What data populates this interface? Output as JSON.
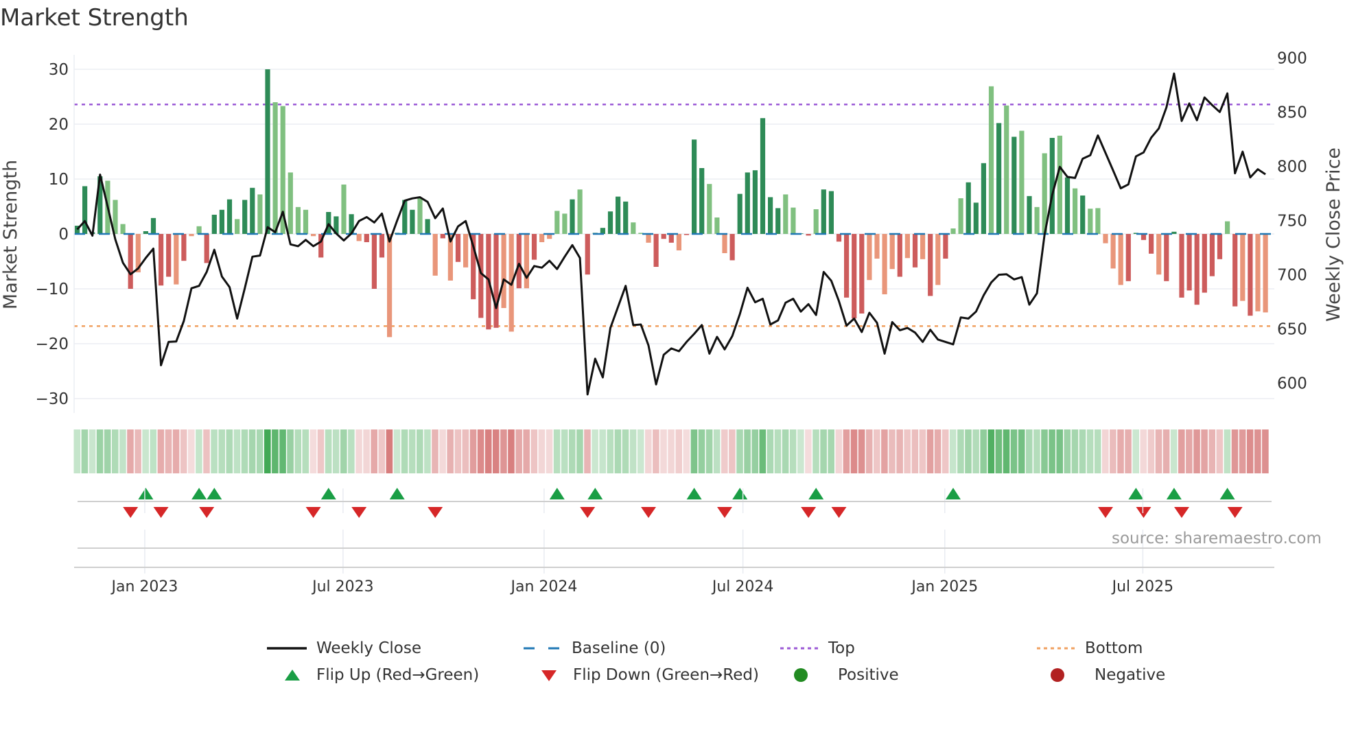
{
  "title": "Market Strength",
  "source": "source: sharemaestro.com",
  "legend": {
    "weekly_close": "Weekly Close",
    "baseline": "Baseline (0)",
    "top": "Top",
    "bottom": "Bottom",
    "flip_up": "Flip Up (Red→Green)",
    "flip_down": "Flip Down (Green→Red)",
    "positive": "Positive",
    "negative": "Negative"
  },
  "colors": {
    "strong_positive": "#2e8b57",
    "weak_positive": "#80c080",
    "strong_negative": "#cd5c5c",
    "weak_negative": "#e9967a",
    "line": "#111111",
    "baseline": "#1f77b4",
    "top": "#9b59d6",
    "bottom": "#f0a060",
    "flip_up": "#1a9e45",
    "flip_down": "#d62728",
    "positive_dot": "#228b22",
    "negative_dot": "#b22222"
  },
  "chart_data": {
    "type": "bar+line",
    "title": "Market Strength",
    "ylabel": "Market Strength",
    "y2label": "Weekly Close Price",
    "ylim": [
      -33,
      33
    ],
    "yticks": [
      30,
      20,
      10,
      0,
      -10,
      -20,
      -30
    ],
    "ytick_labels": [
      "30",
      "20",
      "10",
      "0",
      "−10",
      "−20",
      "−30"
    ],
    "y2ticks": [
      900,
      850,
      800,
      750,
      700,
      650,
      600
    ],
    "y2tick_labels": [
      "900",
      "850",
      "800",
      "750",
      "700",
      "650",
      "600"
    ],
    "x_unit": "week index (weekly, ~Nov 2022 – Oct 2025)",
    "xticks": [
      {
        "week": 8.87,
        "label": "Jan 2023"
      },
      {
        "week": 34.9,
        "label": "Jul 2023"
      },
      {
        "week": 61.3,
        "label": "Jan 2024"
      },
      {
        "week": 87.4,
        "label": "Jul 2024"
      },
      {
        "week": 113.9,
        "label": "Jan 2025"
      },
      {
        "week": 139.9,
        "label": "Jul 2025"
      }
    ],
    "top_level": 23.6,
    "bottom_level": -16.8,
    "baseline": 0,
    "strength": [
      1.5,
      8.7,
      0.3,
      10.5,
      9.7,
      6.2,
      1.8,
      -10,
      -7,
      0.5,
      2.9,
      -9.4,
      -7.8,
      -9.2,
      -4.9,
      -0.4,
      1.4,
      -5.3,
      3.5,
      4.4,
      6.3,
      2.7,
      6.2,
      8.4,
      7.2,
      30,
      24,
      23.3,
      11.2,
      4.9,
      4.4,
      -0.4,
      -4.3,
      4,
      3.2,
      9,
      3.6,
      -1.3,
      -1.5,
      -10,
      -4.3,
      -18.8,
      0.2,
      6.2,
      4.4,
      6.6,
      2.7,
      -7.6,
      -0.8,
      -8.5,
      -5.1,
      -6.1,
      -11.9,
      -15.3,
      -17.4,
      -17.1,
      -13.5,
      -17.8,
      -9.9,
      -9.9,
      -4.7,
      -1.5,
      -0.9,
      4.2,
      3.7,
      6.3,
      8.1,
      -7.4,
      0.2,
      1.1,
      4.1,
      6.8,
      5.9,
      2.1,
      0.2,
      -1.6,
      -6,
      -0.9,
      -1.6,
      -3,
      -0.2,
      17.2,
      12,
      9.1,
      3,
      -3.5,
      -4.8,
      7.3,
      11.2,
      11.6,
      21.1,
      6.7,
      4.7,
      7.2,
      4.8,
      0.1,
      -0.3,
      4.5,
      8.1,
      7.8,
      -1.4,
      -11.6,
      -15.4,
      -14.5,
      -8.4,
      -4.5,
      -11,
      -6.4,
      -7.8,
      -4.4,
      -6.1,
      -4.6,
      -11.3,
      -9.3,
      -4.5,
      1,
      6.5,
      9.4,
      5.7,
      12.9,
      26.9,
      20.2,
      23.4,
      17.7,
      18.8,
      6.9,
      4.9,
      14.7,
      17.5,
      17.9,
      10.3,
      8.3,
      7,
      4.6,
      4.7,
      -1.7,
      -6.3,
      -9.3,
      -8.6,
      0.2,
      -1.1,
      -3.6,
      -7.4,
      -8.6,
      0.4,
      -11.6,
      -10.3,
      -12.9,
      -10.7,
      -7.7,
      -4.6,
      2.3,
      -13.2,
      -12.2,
      -14.9,
      -14.1,
      -14.3
    ],
    "strength_tone": "ddddllldlddddldllddddlddldlllllldddldldddldddldldldlddddlldldlllldlddddddllldddldddllldddddddllddlddddddlllldldldldlldddldldldlldldldlllllddddlddddddddldldlllddldldlld",
    "weekly_close": [
      741.7,
      749.4,
      735.9,
      792.3,
      762.8,
      732.6,
      711,
      700.3,
      705.7,
      715.4,
      724,
      616.4,
      637.9,
      638.3,
      657.3,
      687.4,
      689.6,
      702.5,
      722.9,
      698.2,
      688.5,
      659.4,
      687.4,
      716.5,
      717.6,
      743.8,
      739.1,
      758,
      727.9,
      726.2,
      732,
      726.2,
      730.5,
      746.6,
      738,
      731.5,
      738,
      749.4,
      753.1,
      748.1,
      756.3,
      730.5,
      749.8,
      768.2,
      770.3,
      771.4,
      767.1,
      752,
      761,
      730.5,
      744.5,
      749.4,
      726.2,
      701.4,
      695.6,
      669.1,
      695.6,
      690.6,
      710,
      697.1,
      707.9,
      706.4,
      712.8,
      705.1,
      716.5,
      727.2,
      715.4,
      589.5,
      622.4,
      605.2,
      650.8,
      670.2,
      689.6,
      653.4,
      654,
      634.7,
      598.7,
      626.1,
      631.9,
      629.3,
      637.9,
      645.4,
      653.4,
      627.1,
      642.6,
      631,
      643.3,
      663.7,
      687.9,
      674.5,
      677.7,
      654,
      657.7,
      674.1,
      677.7,
      665.9,
      672.8,
      662.7,
      702.5,
      694.3,
      675.6,
      653,
      659.4,
      647,
      664.8,
      655.6,
      627.1,
      656.2,
      648.7,
      650.8,
      646.5,
      637.9,
      649.1,
      640.1,
      637.9,
      635.7,
      660.5,
      659.4,
      665.9,
      680.9,
      692.8,
      699.9,
      700.3,
      695.6,
      697.7,
      672.3,
      682.7,
      736.9,
      773.5,
      799.4,
      790.1,
      789.2,
      806.9,
      810.1,
      828.4,
      812.3,
      796.1,
      779.6,
      783.2,
      809.1,
      812.7,
      826.3,
      834.9,
      854.3,
      885.5,
      841.8,
      857.9,
      842.4,
      863.5,
      856.4,
      850,
      867.2,
      793.5,
      813.4,
      789.7,
      797.2,
      792.5
    ],
    "flip_up_weeks": [
      9,
      16,
      18,
      33,
      42,
      63,
      68,
      81,
      87,
      97,
      115,
      139,
      144,
      151
    ],
    "flip_down_weeks": [
      7,
      11,
      17,
      31,
      37,
      47,
      67,
      75,
      85,
      96,
      100,
      135,
      140,
      145,
      152
    ],
    "legend_position": "bottom"
  }
}
